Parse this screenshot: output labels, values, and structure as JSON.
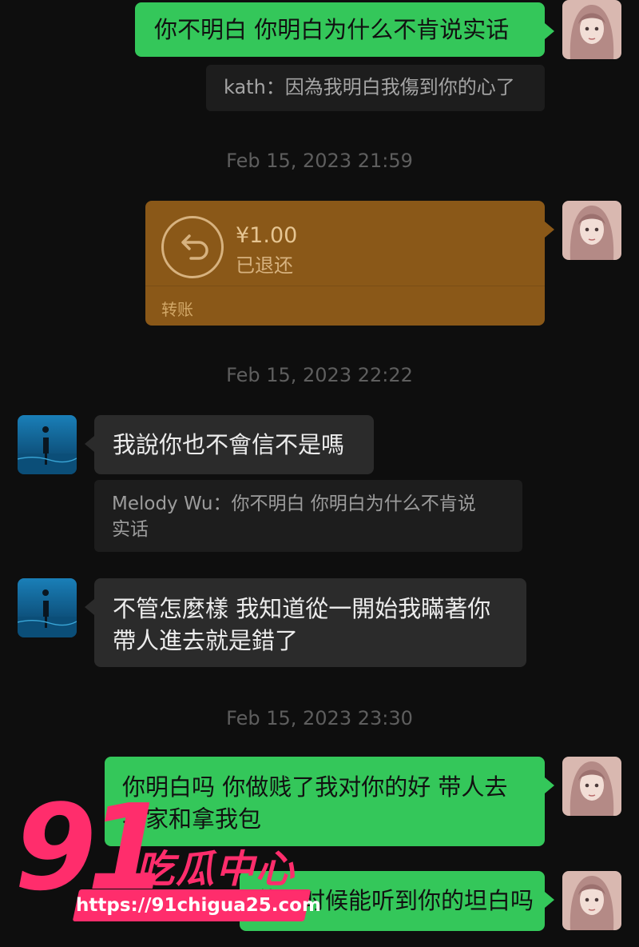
{
  "colors": {
    "sent_bubble": "#34c75a",
    "received_bubble": "#2b2b2b",
    "transfer_card": "#8a5818",
    "watermark": "#ff2d6c",
    "background": "#0e0e0e"
  },
  "messages": {
    "m1": {
      "text": "你不明白 你明白为什么不肯说实话"
    },
    "q1": {
      "text": "kath：因為我明白我傷到你的心了"
    },
    "t1": "Feb 15, 2023 21:59",
    "transfer": {
      "amount": "¥1.00",
      "status": "已退还",
      "type": "转账",
      "icon": "return-arrow-icon"
    },
    "t2": "Feb 15, 2023 22:22",
    "m2": {
      "text": "我說你也不會信不是嗎"
    },
    "q2": {
      "line1": "Melody Wu：你不明白 你明白为什么不肯说",
      "line2": "实话"
    },
    "m3": {
      "line1": "不管怎麼樣 我知道從一開始我瞞著你",
      "line2": "帶人進去就是錯了"
    },
    "t3": "Feb 15, 2023 23:30",
    "m4": {
      "line1": "你明白吗 你做贱了我对你的好 带人去",
      "line2": "我家和拿我包"
    },
    "m5": {
      "text": "什么时候能听到你的坦白吗"
    }
  },
  "watermark": {
    "number": "91",
    "name": "吃瓜中心",
    "url": "https://91chigua25.com"
  }
}
